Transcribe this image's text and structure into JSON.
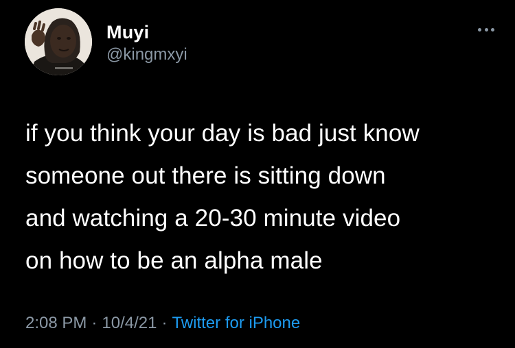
{
  "user": {
    "display_name": "Muyi",
    "handle": "@kingmxyi"
  },
  "tweet": {
    "lines": [
      "if you think your day is bad just know",
      "someone out there is sitting down",
      "and watching a 20-30 minute video",
      "on how to be an alpha male"
    ]
  },
  "meta": {
    "time": "2:08 PM",
    "separator": "·",
    "date": "10/4/21",
    "source": "Twitter for iPhone"
  },
  "icons": {
    "more": "more-horizontal-icon"
  },
  "colors": {
    "background": "#000000",
    "text": "#ffffff",
    "secondary": "#8b98a5",
    "link": "#1d9bf0"
  }
}
